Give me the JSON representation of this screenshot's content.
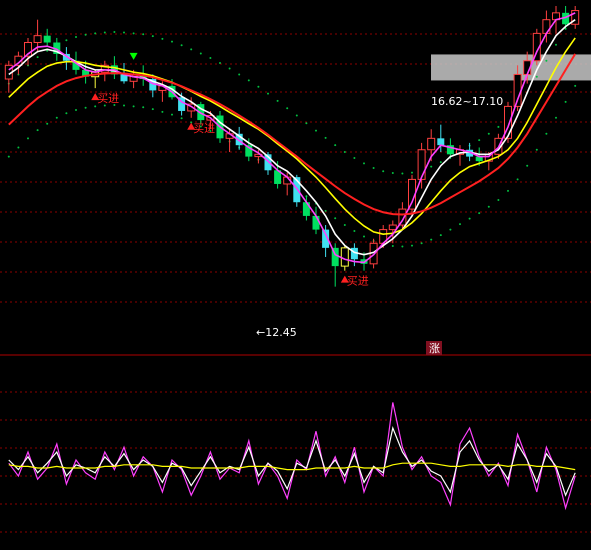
{
  "colors": {
    "background": "#000000",
    "grid": "#8b0000",
    "panel_divider": "#b00000",
    "candle_up": "#ff4040",
    "candle_down": "#00e060",
    "candle_alt": "#40e0f0",
    "highlight_candle": "#ffff40",
    "ma_white": "#ffffff",
    "ma_yellow": "#ffff00",
    "ma_magenta": "#ff40ff",
    "ma_red": "#ff2020",
    "dot_band": "#00c040",
    "buy_marker": "#ff2020",
    "sell_marker": "#00ff00",
    "price_label": "#ffffff",
    "range_box": "#c8c8c8",
    "osc_white": "#ffffff",
    "osc_magenta": "#ff40ff",
    "osc_yellow": "#ffff00"
  },
  "chart_data": [
    {
      "type": "candlestick",
      "panel": "main",
      "title": "",
      "ylim": [
        11.5,
        18.6
      ],
      "grid": true,
      "annotations": {
        "buy_label": "买进",
        "low_label": "←12.45",
        "range_label": "16.62~17.10",
        "rise_badge": "涨"
      },
      "candles": [
        [
          17.0,
          17.4,
          16.7,
          17.3
        ],
        [
          17.3,
          17.6,
          17.1,
          17.5
        ],
        [
          17.5,
          17.9,
          17.3,
          17.8
        ],
        [
          17.8,
          18.3,
          17.6,
          17.95
        ],
        [
          17.95,
          18.1,
          17.7,
          17.8
        ],
        [
          17.8,
          17.9,
          17.4,
          17.55
        ],
        [
          17.55,
          17.7,
          17.2,
          17.4
        ],
        [
          17.4,
          17.6,
          17.1,
          17.2
        ],
        [
          17.2,
          17.4,
          16.9,
          17.05
        ],
        [
          17.05,
          17.2,
          16.8,
          17.15
        ],
        [
          17.15,
          17.4,
          16.95,
          17.3
        ],
        [
          17.3,
          17.5,
          17.0,
          17.1
        ],
        [
          17.1,
          17.35,
          16.9,
          16.95
        ],
        [
          16.95,
          17.2,
          16.8,
          17.1
        ],
        [
          17.1,
          17.3,
          16.85,
          17.0
        ],
        [
          17.0,
          17.1,
          16.6,
          16.75
        ],
        [
          16.75,
          16.95,
          16.5,
          16.85
        ],
        [
          16.85,
          17.0,
          16.55,
          16.6
        ],
        [
          16.6,
          16.7,
          16.2,
          16.3
        ],
        [
          16.3,
          16.6,
          16.15,
          16.45
        ],
        [
          16.45,
          16.5,
          16.0,
          16.1
        ],
        [
          16.1,
          16.3,
          15.9,
          16.2
        ],
        [
          16.2,
          16.3,
          15.6,
          15.7
        ],
        [
          15.7,
          15.9,
          15.4,
          15.8
        ],
        [
          15.8,
          15.95,
          15.45,
          15.55
        ],
        [
          15.55,
          15.7,
          15.2,
          15.3
        ],
        [
          15.3,
          15.45,
          15.15,
          15.35
        ],
        [
          15.35,
          15.4,
          14.9,
          15.0
        ],
        [
          15.0,
          15.2,
          14.6,
          14.7
        ],
        [
          14.7,
          14.95,
          14.45,
          14.85
        ],
        [
          14.85,
          14.9,
          14.2,
          14.3
        ],
        [
          14.3,
          14.45,
          13.9,
          14.0
        ],
        [
          14.0,
          14.2,
          13.6,
          13.7
        ],
        [
          13.7,
          13.8,
          13.1,
          13.3
        ],
        [
          13.3,
          13.4,
          12.45,
          12.9
        ],
        [
          12.9,
          13.35,
          12.8,
          13.3
        ],
        [
          13.3,
          13.4,
          12.9,
          13.05
        ],
        [
          13.05,
          13.2,
          12.8,
          12.95
        ],
        [
          12.95,
          13.5,
          12.85,
          13.4
        ],
        [
          13.4,
          13.8,
          13.3,
          13.7
        ],
        [
          13.7,
          13.9,
          13.4,
          13.8
        ],
        [
          13.8,
          14.3,
          13.7,
          14.15
        ],
        [
          14.15,
          14.9,
          14.05,
          14.8
        ],
        [
          14.8,
          15.6,
          14.6,
          15.45
        ],
        [
          15.45,
          15.9,
          15.2,
          15.7
        ],
        [
          15.7,
          16.0,
          15.4,
          15.55
        ],
        [
          15.55,
          15.7,
          15.25,
          15.35
        ],
        [
          15.35,
          15.55,
          15.1,
          15.45
        ],
        [
          15.45,
          15.6,
          15.2,
          15.3
        ],
        [
          15.3,
          15.5,
          15.1,
          15.2
        ],
        [
          15.2,
          15.4,
          15.0,
          15.35
        ],
        [
          15.35,
          15.8,
          15.25,
          15.7
        ],
        [
          15.7,
          16.5,
          15.6,
          16.4
        ],
        [
          16.4,
          17.3,
          16.3,
          17.1
        ],
        [
          17.1,
          17.6,
          16.9,
          17.4
        ],
        [
          17.4,
          18.1,
          17.3,
          18.0
        ],
        [
          18.0,
          18.5,
          17.8,
          18.3
        ],
        [
          18.3,
          18.6,
          18.0,
          18.45
        ],
        [
          18.45,
          18.6,
          18.1,
          18.2
        ],
        [
          18.2,
          18.6,
          18.1,
          18.5
        ]
      ],
      "lines": {
        "ma_white": [
          17.1,
          17.25,
          17.45,
          17.6,
          17.65,
          17.6,
          17.5,
          17.38,
          17.27,
          17.2,
          17.2,
          17.18,
          17.1,
          17.05,
          17.03,
          16.95,
          16.88,
          16.78,
          16.62,
          16.5,
          16.35,
          16.25,
          16.05,
          15.9,
          15.75,
          15.6,
          15.48,
          15.3,
          15.1,
          14.98,
          14.78,
          14.55,
          14.3,
          14.0,
          13.6,
          13.35,
          13.2,
          13.15,
          13.2,
          13.35,
          13.5,
          13.7,
          14.0,
          14.4,
          14.8,
          15.1,
          15.3,
          15.38,
          15.4,
          15.35,
          15.35,
          15.45,
          15.75,
          16.2,
          16.7,
          17.2,
          17.6,
          17.95,
          18.15,
          18.3
        ],
        "ma_yellow": [
          16.6,
          16.8,
          17.0,
          17.15,
          17.28,
          17.35,
          17.38,
          17.38,
          17.35,
          17.3,
          17.27,
          17.25,
          17.2,
          17.15,
          17.12,
          17.07,
          17.0,
          16.93,
          16.83,
          16.73,
          16.62,
          16.52,
          16.4,
          16.27,
          16.15,
          16.02,
          15.9,
          15.75,
          15.58,
          15.42,
          15.25,
          15.05,
          14.85,
          14.62,
          14.38,
          14.15,
          13.95,
          13.78,
          13.65,
          13.6,
          13.62,
          13.7,
          13.85,
          14.05,
          14.3,
          14.55,
          14.78,
          14.95,
          15.08,
          15.15,
          15.22,
          15.3,
          15.45,
          15.7,
          16.05,
          16.45,
          16.85,
          17.25,
          17.6,
          17.9
        ],
        "ma_magenta": [
          17.2,
          17.35,
          17.55,
          17.7,
          17.72,
          17.65,
          17.5,
          17.35,
          17.2,
          17.15,
          17.2,
          17.2,
          17.1,
          17.05,
          17.02,
          16.9,
          16.85,
          16.72,
          16.5,
          16.4,
          16.25,
          16.15,
          15.95,
          15.8,
          15.65,
          15.5,
          15.38,
          15.2,
          15.0,
          14.85,
          14.6,
          14.3,
          14.0,
          13.6,
          13.15,
          13.05,
          13.0,
          12.98,
          13.15,
          13.4,
          13.6,
          13.9,
          14.3,
          14.85,
          15.3,
          15.55,
          15.5,
          15.45,
          15.4,
          15.3,
          15.3,
          15.5,
          15.95,
          16.55,
          17.1,
          17.6,
          18.0,
          18.3,
          18.35,
          18.45
        ],
        "ma_red": [
          16.0,
          16.2,
          16.4,
          16.58,
          16.72,
          16.85,
          16.95,
          17.02,
          17.07,
          17.1,
          17.12,
          17.13,
          17.12,
          17.1,
          17.08,
          17.04,
          16.98,
          16.92,
          16.84,
          16.75,
          16.66,
          16.56,
          16.45,
          16.33,
          16.2,
          16.07,
          15.93,
          15.78,
          15.62,
          15.46,
          15.3,
          15.13,
          14.97,
          14.81,
          14.65,
          14.5,
          14.37,
          14.25,
          14.15,
          14.08,
          14.04,
          14.03,
          14.05,
          14.1,
          14.18,
          14.28,
          14.4,
          14.52,
          14.64,
          14.76,
          14.9,
          15.05,
          15.25,
          15.5,
          15.8,
          16.15,
          16.5,
          16.85,
          17.2,
          17.55
        ]
      },
      "buy_signal_indices": [
        9,
        19,
        35
      ],
      "sell_signal_indices": [
        13
      ],
      "range_band": [
        16.62,
        17.1
      ]
    },
    {
      "type": "line",
      "panel": "oscillator",
      "title": "",
      "ylim": [
        0,
        100
      ],
      "grid": true,
      "series": [
        {
          "color_key": "osc_magenta",
          "values": [
            48,
            40,
            55,
            38,
            45,
            60,
            35,
            50,
            42,
            38,
            55,
            44,
            58,
            40,
            52,
            46,
            30,
            50,
            44,
            28,
            40,
            55,
            38,
            45,
            42,
            62,
            35,
            48,
            40,
            26,
            50,
            44,
            68,
            40,
            52,
            36,
            58,
            30,
            46,
            40,
            86,
            58,
            44,
            52,
            40,
            36,
            22,
            60,
            70,
            52,
            40,
            48,
            34,
            66,
            50,
            30,
            58,
            44,
            20,
            40
          ]
        },
        {
          "color_key": "osc_white",
          "values": [
            50,
            44,
            52,
            42,
            48,
            55,
            40,
            47,
            45,
            42,
            52,
            46,
            54,
            44,
            50,
            46,
            36,
            48,
            45,
            34,
            43,
            52,
            42,
            46,
            44,
            58,
            40,
            48,
            43,
            32,
            48,
            45,
            62,
            43,
            50,
            40,
            54,
            36,
            46,
            42,
            70,
            55,
            46,
            50,
            43,
            40,
            30,
            55,
            62,
            50,
            43,
            47,
            38,
            60,
            50,
            36,
            54,
            46,
            28,
            42
          ]
        },
        {
          "color_key": "osc_yellow",
          "values": [
            47,
            46,
            46,
            45,
            45,
            46,
            45,
            45,
            45,
            45,
            46,
            46,
            47,
            47,
            47,
            47,
            46,
            46,
            46,
            45,
            45,
            45,
            45,
            45,
            45,
            46,
            46,
            46,
            45,
            44,
            44,
            44,
            45,
            45,
            45,
            45,
            46,
            45,
            45,
            45,
            47,
            48,
            48,
            48,
            48,
            47,
            46,
            46,
            47,
            47,
            47,
            47,
            46,
            47,
            47,
            46,
            46,
            46,
            45,
            44
          ]
        }
      ]
    }
  ]
}
